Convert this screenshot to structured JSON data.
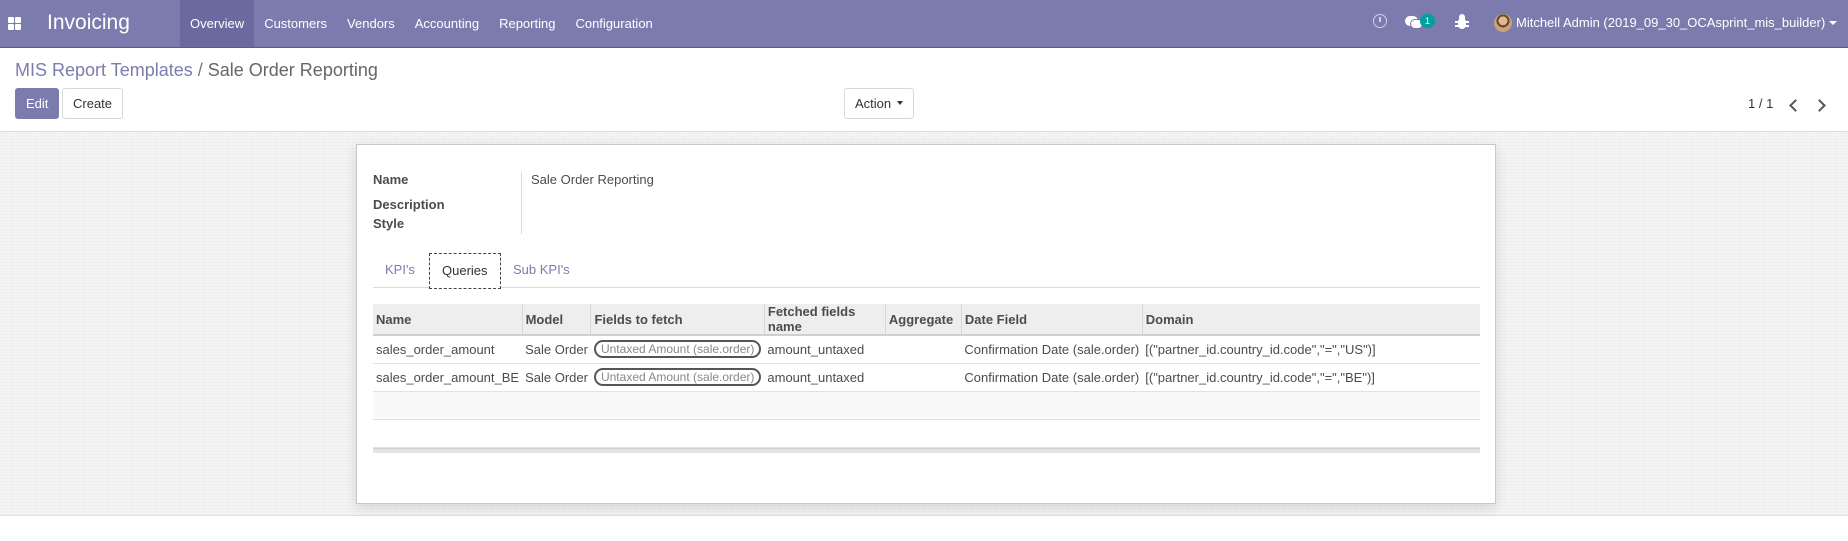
{
  "navbar": {
    "app_name": "Invoicing",
    "menu": [
      "Overview",
      "Customers",
      "Vendors",
      "Accounting",
      "Reporting",
      "Configuration"
    ],
    "active_menu": "Overview",
    "message_count": "1",
    "user_name": "Mitchell Admin (2019_09_30_OCAsprint_mis_builder)"
  },
  "breadcrumb": {
    "parent": "MIS Report Templates",
    "separator": "/",
    "current": "Sale Order Reporting"
  },
  "buttons": {
    "edit": "Edit",
    "create": "Create",
    "action": "Action"
  },
  "pager": {
    "value": "1 / 1"
  },
  "form": {
    "name_label": "Name",
    "name_value": "Sale Order Reporting",
    "description_label": "Description",
    "style_label": "Style"
  },
  "tabs": {
    "kpis": "KPI's",
    "queries": "Queries",
    "sub_kpis": "Sub KPI's",
    "active": "Queries"
  },
  "queries_table": {
    "columns": [
      "Name",
      "Model",
      "Fields to fetch",
      "Fetched fields name",
      "Aggregate",
      "Date Field",
      "Domain"
    ],
    "rows": [
      {
        "name": "sales_order_amount",
        "model": "Sale Order",
        "fields_to_fetch": "Untaxed Amount (sale.order)",
        "fetched_fields_name": "amount_untaxed",
        "aggregate": "",
        "date_field": "Confirmation Date (sale.order)",
        "domain": "[(\"partner_id.country_id.code\",\"=\",\"US\")]"
      },
      {
        "name": "sales_order_amount_BE",
        "model": "Sale Order",
        "fields_to_fetch": "Untaxed Amount (sale.order)",
        "fetched_fields_name": "amount_untaxed",
        "aggregate": "",
        "date_field": "Confirmation Date (sale.order)",
        "domain": "[(\"partner_id.country_id.code\",\"=\",\"BE\")]"
      }
    ]
  },
  "colors": {
    "brand": "#7c7bad",
    "badge": "#00a09d"
  }
}
